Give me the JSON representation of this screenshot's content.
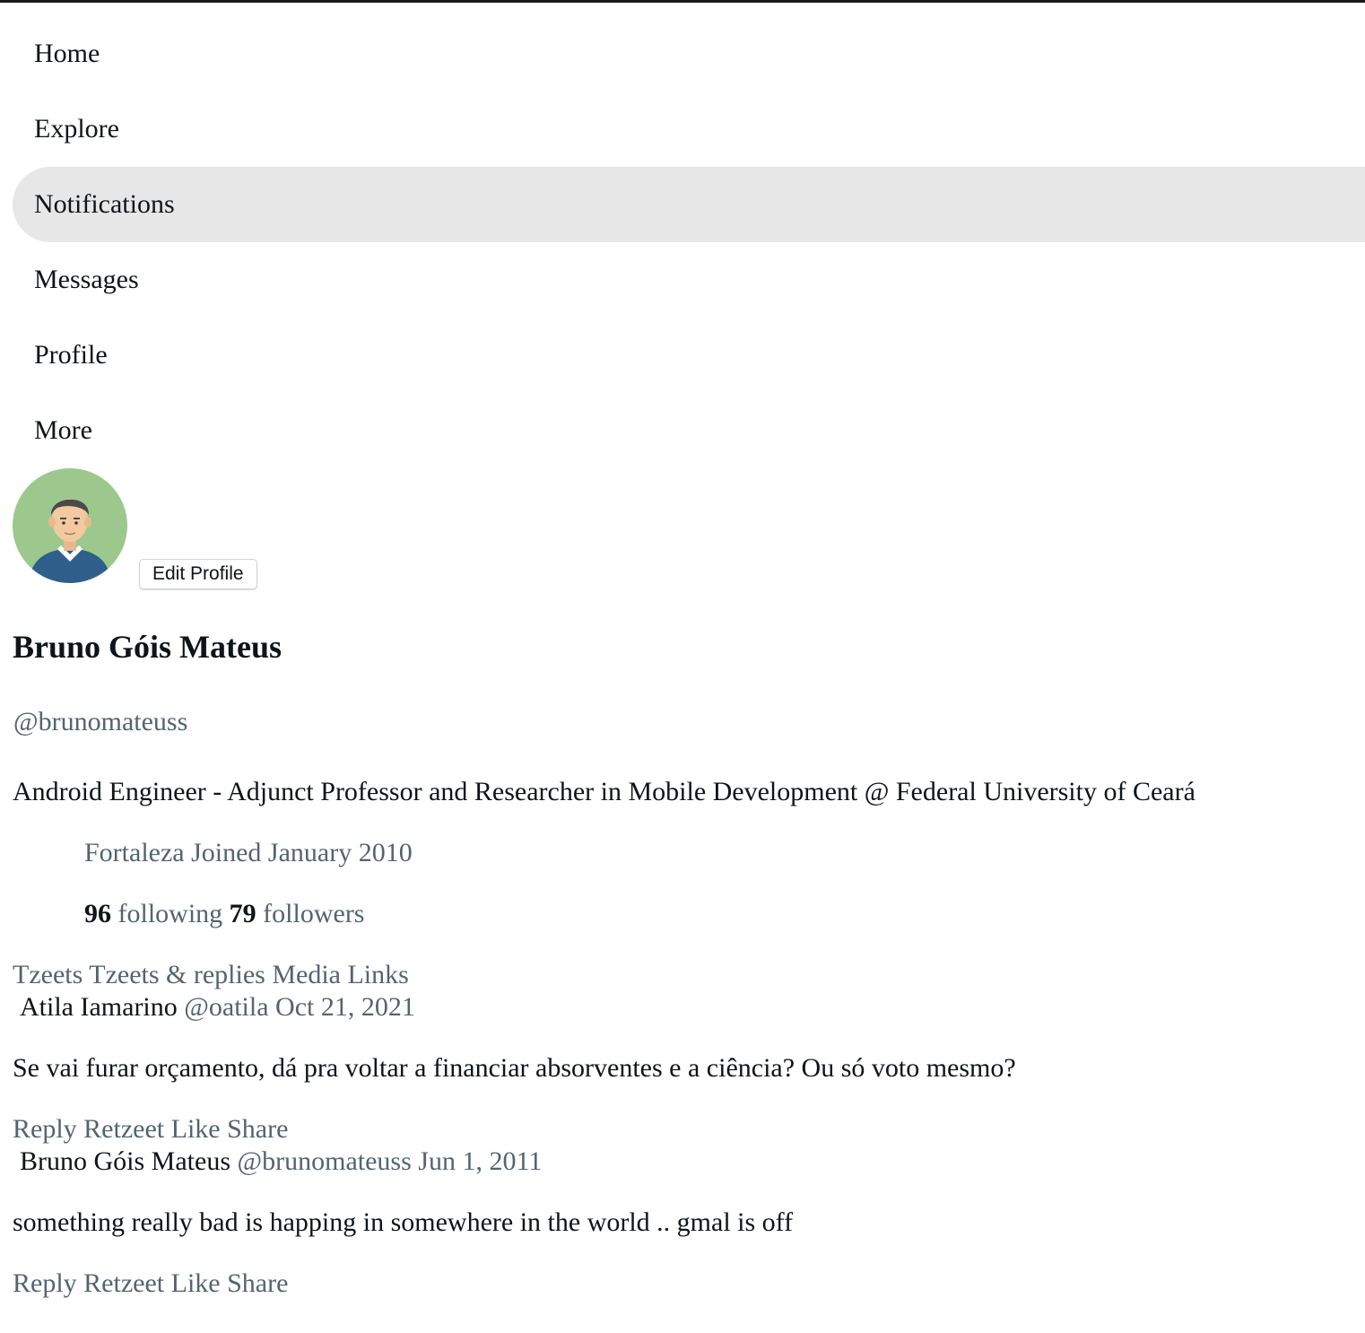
{
  "nav": {
    "items": [
      {
        "label": "Home"
      },
      {
        "label": "Explore"
      },
      {
        "label": "Notifications"
      },
      {
        "label": "Messages"
      },
      {
        "label": "Profile"
      },
      {
        "label": "More"
      }
    ],
    "active": "Notifications"
  },
  "profile": {
    "edit_button": "Edit Profile",
    "name": "Bruno Góis Mateus",
    "handle": "@brunomateuss",
    "bio": "Android Engineer - Adjunct Professor and Researcher in Mobile Development @ Federal University of Ceará",
    "location": "Fortaleza",
    "joined": "Joined January 2010",
    "following_count": "96",
    "following_label": "following",
    "followers_count": "79",
    "followers_label": "followers"
  },
  "tabs": [
    "Tzeets",
    "Tzeets & replies",
    "Media",
    "Links"
  ],
  "tweets": [
    {
      "author": "Atila Iamarino",
      "handle": "@oatila",
      "date": "Oct 21, 2021",
      "text": "Se vai furar orçamento, dá pra voltar a financiar absorventes e a ciência? Ou só voto mesmo?",
      "actions": [
        "Reply",
        "Retzeet",
        "Like",
        "Share"
      ]
    },
    {
      "author": "Bruno Góis Mateus",
      "handle": "@brunomateuss",
      "date": "Jun 1, 2011",
      "text": "something really bad is happing in somewhere in the world .. gmal is off",
      "actions": [
        "Reply",
        "Retzeet",
        "Like",
        "Share"
      ]
    }
  ],
  "colors": {
    "muted": "#536471",
    "active_nav_bg": "#e7e7e7",
    "avatar_bg": "#9dc88d",
    "avatar_shirt": "#2f5f8a"
  }
}
